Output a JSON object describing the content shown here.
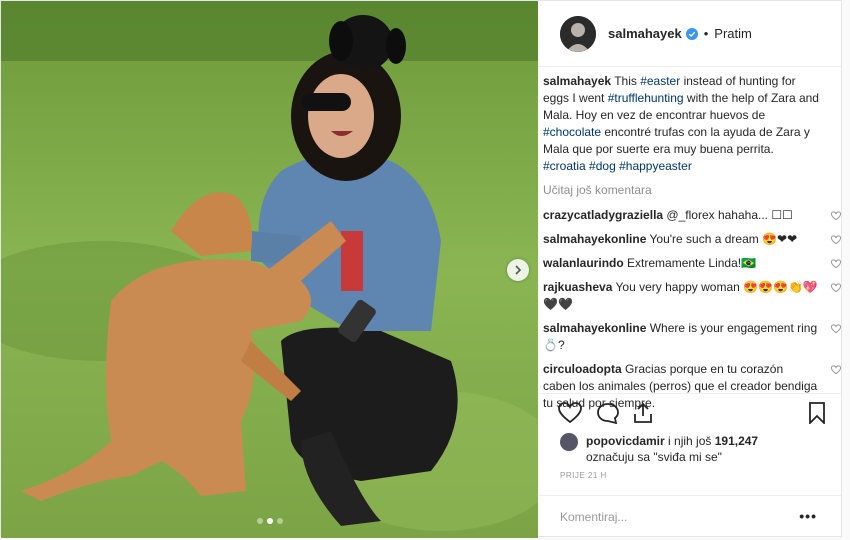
{
  "header": {
    "username": "salmahayek",
    "separator": "•",
    "follow_label": "Pratim"
  },
  "caption": {
    "username": "salmahayek",
    "parts": [
      {
        "t": "This ",
        "tag": false
      },
      {
        "t": "#easter",
        "tag": true
      },
      {
        "t": " instead of hunting for eggs I went ",
        "tag": false
      },
      {
        "t": "#trufflehunting",
        "tag": true
      },
      {
        "t": " with the help of Zara and Mala. Hoy en vez de encontrar huevos de ",
        "tag": false
      },
      {
        "t": "#chocolate",
        "tag": true
      },
      {
        "t": " encontré trufas con la ayuda de Zara y Mala que por suerte era muy buena perrita. ",
        "tag": false
      },
      {
        "t": "#croatia",
        "tag": true
      },
      {
        "t": " ",
        "tag": false
      },
      {
        "t": "#dog",
        "tag": true
      },
      {
        "t": " ",
        "tag": false
      },
      {
        "t": "#happyeaster",
        "tag": true
      }
    ]
  },
  "load_more": "Učitaj još komentara",
  "comments": [
    {
      "user": "crazycatladygraziella",
      "text": "@_florex hahaha... ☐☐",
      "mention": true
    },
    {
      "user": "salmahayekonline",
      "text": "You're such a dream 😍❤❤",
      "mention": false
    },
    {
      "user": "walanlaurindo",
      "text": "Extremamente Linda!🇧🇷",
      "mention": false
    },
    {
      "user": "rajkuasheva",
      "text": "You very happy woman 😍😍😍👏💖 🖤🖤",
      "mention": false
    },
    {
      "user": "salmahayekonline",
      "text": "Where is your engagement ring 💍?",
      "mention": false
    },
    {
      "user": "circuloadopta",
      "text": "Gracias porque en tu corazón caben los animales (perros) que el creador bendiga tu salud por siempre.",
      "mention": false
    }
  ],
  "likes": {
    "user": "popovicdamir",
    "text_1": " i njih još ",
    "count": "191,247",
    "text_2": "označuju sa \"sviđa mi se\""
  },
  "time": "PRIJE 21 H",
  "add_comment_placeholder": "Komentiraj...",
  "more_label": "•••",
  "icons": {
    "like": "heart-icon",
    "comment": "comment-bubble-icon",
    "share": "share-icon",
    "save": "bookmark-icon",
    "verified": "verified-badge-icon",
    "next": "chevron-right-icon"
  },
  "colors": {
    "hashtag": "#003569",
    "verified": "#3897f0",
    "text": "#262626",
    "muted": "#8e8e8e"
  },
  "carousel": {
    "count": 3,
    "active": 1
  }
}
